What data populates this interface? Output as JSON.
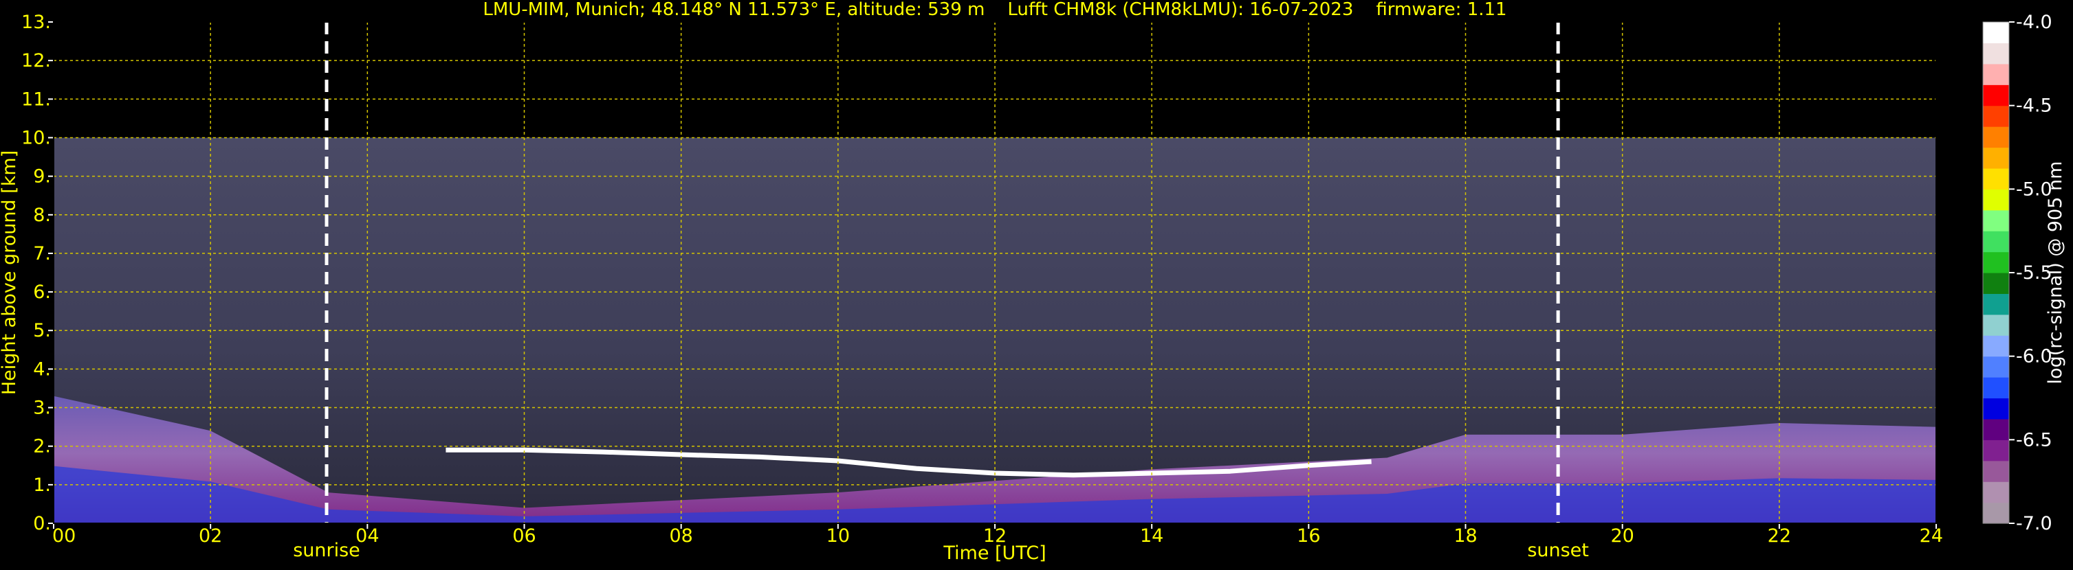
{
  "chart_data": {
    "type": "heatmap",
    "title": "LMU-MIM, Munich; 48.148° N 11.573° E, altitude: 539 m    Lufft CHM8k (CHM8kLMU): 16-07-2023    firmware: 1.11",
    "xlabel": "Time [UTC]",
    "ylabel": "Height above ground [km]",
    "xlim": [
      0,
      24
    ],
    "ylim": [
      0,
      13
    ],
    "x_ticks": [
      {
        "value": 0,
        "label": "00"
      },
      {
        "value": 2,
        "label": "02"
      },
      {
        "value": 4,
        "label": "04"
      },
      {
        "value": 6,
        "label": "06"
      },
      {
        "value": 8,
        "label": "08"
      },
      {
        "value": 10,
        "label": "10"
      },
      {
        "value": 12,
        "label": "12"
      },
      {
        "value": 14,
        "label": "14"
      },
      {
        "value": 16,
        "label": "16"
      },
      {
        "value": 18,
        "label": "18"
      },
      {
        "value": 20,
        "label": "20"
      },
      {
        "value": 22,
        "label": "22"
      },
      {
        "value": 24,
        "label": "24"
      }
    ],
    "y_ticks": [
      {
        "value": 0,
        "label": "0."
      },
      {
        "value": 1,
        "label": "1."
      },
      {
        "value": 2,
        "label": "2."
      },
      {
        "value": 3,
        "label": "3."
      },
      {
        "value": 4,
        "label": "4."
      },
      {
        "value": 5,
        "label": "5."
      },
      {
        "value": 6,
        "label": "6."
      },
      {
        "value": 7,
        "label": "7."
      },
      {
        "value": 8,
        "label": "8."
      },
      {
        "value": 9,
        "label": "9."
      },
      {
        "value": 10,
        "label": "10."
      },
      {
        "value": 11,
        "label": "11."
      },
      {
        "value": 12,
        "label": "12."
      },
      {
        "value": 13,
        "label": "13."
      }
    ],
    "grid": true,
    "data_top_km": 10,
    "markers": [
      {
        "label": "sunrise",
        "time": 3.48
      },
      {
        "label": "sunset",
        "time": 19.18
      }
    ],
    "cloud_layer": [
      [
        5.0,
        1.9
      ],
      [
        6.0,
        1.9
      ],
      [
        7.0,
        1.85
      ],
      [
        8.0,
        1.78
      ],
      [
        9.0,
        1.72
      ],
      [
        10.0,
        1.62
      ],
      [
        11.0,
        1.42
      ],
      [
        12.0,
        1.3
      ],
      [
        13.0,
        1.25
      ],
      [
        14.0,
        1.3
      ],
      [
        15.0,
        1.35
      ],
      [
        16.0,
        1.5
      ],
      [
        16.8,
        1.6
      ]
    ],
    "aerosol_top": [
      [
        0.0,
        3.3
      ],
      [
        2.0,
        2.4
      ],
      [
        3.5,
        0.8
      ],
      [
        6.0,
        0.4
      ],
      [
        10.0,
        0.8
      ],
      [
        14.0,
        1.4
      ],
      [
        17.0,
        1.7
      ],
      [
        18.0,
        2.3
      ],
      [
        20.0,
        2.3
      ],
      [
        22.0,
        2.6
      ],
      [
        24.0,
        2.5
      ]
    ],
    "colorbar": {
      "label": "log(rc-signal) @ 905 nm",
      "min": -7.0,
      "max": -4.0,
      "ticks": [
        {
          "value": -4.0,
          "label": "-4.0"
        },
        {
          "value": -4.5,
          "label": "-4.5"
        },
        {
          "value": -5.0,
          "label": "-5.0"
        },
        {
          "value": -5.5,
          "label": "-5.5"
        },
        {
          "value": -6.0,
          "label": "-6.0"
        },
        {
          "value": -6.5,
          "label": "-6.5"
        },
        {
          "value": -7.0,
          "label": "-7.0"
        }
      ],
      "colors": [
        "#a898a8",
        "#b090b0",
        "#98589a",
        "#802090",
        "#600080",
        "#0000e0",
        "#2050ff",
        "#5080ff",
        "#88aaff",
        "#90d0d0",
        "#10a090",
        "#108010",
        "#20c020",
        "#40e060",
        "#80ff80",
        "#e0ff00",
        "#ffe000",
        "#ffb000",
        "#ff8000",
        "#ff4000",
        "#ff0000",
        "#ffb0b0",
        "#f0e0e0",
        "#ffffff"
      ]
    },
    "colors": {
      "axis_text": "#ffff00",
      "grid": "#d4c400",
      "marker": "#ffffff",
      "background": "#000000"
    }
  }
}
